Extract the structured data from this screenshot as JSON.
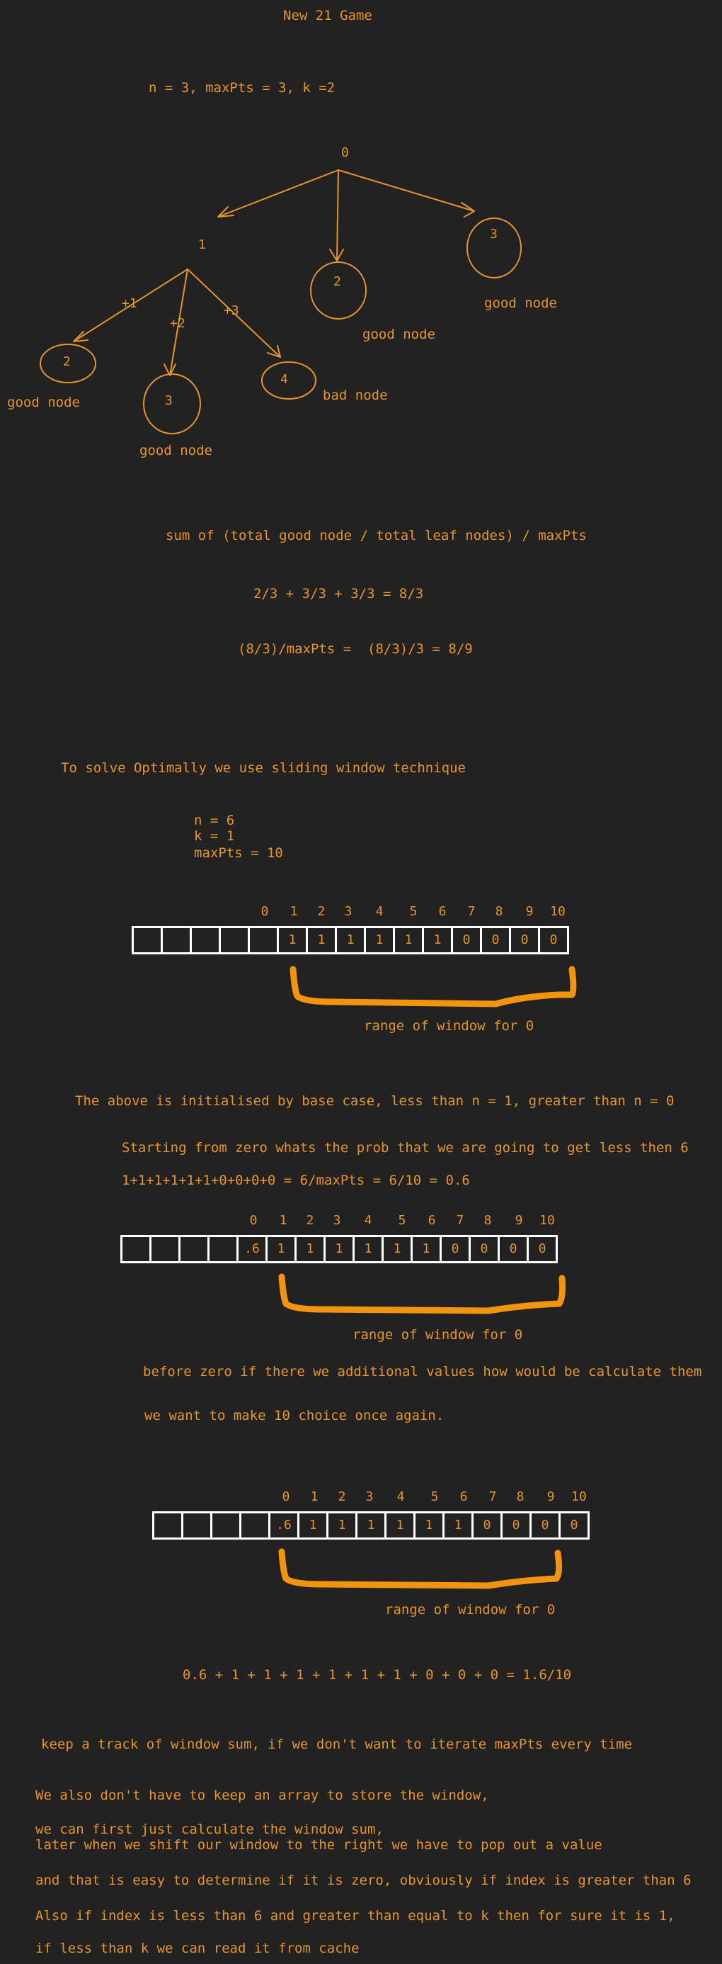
{
  "title": "New 21 Game",
  "params1": "n = 3, maxPts = 3, k =2",
  "tree": {
    "root": "0",
    "n1": "1",
    "n2": "2",
    "n3": "3",
    "e1": "+1",
    "e2": "+2",
    "e3": "+3",
    "l2": "2",
    "l3": "3",
    "l4": "4",
    "lbl_good_n3": "good node",
    "lbl_good_n2": "good node",
    "lbl_good_l2": "good node",
    "lbl_good_l3": "good node",
    "lbl_bad_l4": "bad node"
  },
  "formula1": "sum of (total good node / total leaf nodes) / maxPts",
  "formula2": "2/3 + 3/3 + 3/3 = 8/3",
  "formula3": "(8/3)/maxPts =  (8/3)/3 = 8/9",
  "sliding_title": "To solve Optimally we use sliding window technique",
  "params2": [
    "n = 6",
    "k = 1",
    "maxPts = 10"
  ],
  "indices": [
    "0",
    "1",
    "2",
    "3",
    "4",
    "5",
    "6",
    "7",
    "8",
    "9",
    "10"
  ],
  "array1": [
    "",
    "",
    "",
    "",
    "",
    "1",
    "1",
    "1",
    "1",
    "1",
    "1",
    "0",
    "0",
    "0",
    "0"
  ],
  "array2": [
    "",
    "",
    "",
    "",
    ".6",
    "1",
    "1",
    "1",
    "1",
    "1",
    "1",
    "0",
    "0",
    "0",
    "0"
  ],
  "array3": [
    "",
    "",
    "",
    "",
    ".6",
    "1",
    "1",
    "1",
    "1",
    "1",
    "1",
    "0",
    "0",
    "0",
    "0"
  ],
  "range_label": "range of window for 0",
  "note1": "The above is initialised by base case, less than n = 1, greater than n = 0",
  "note2": "Starting from zero whats the prob that we are going to get less then 6",
  "note3": "1+1+1+1+1+1+0+0+0+0 = 6/maxPts = 6/10 = 0.6",
  "note4": "before zero if there we additional values how would be calculate them",
  "note5": "we want to make 10 choice once again.",
  "note6": "0.6 + 1 + 1 + 1 + 1 + 1 + 1 + 0 + 0 + 0 = 1.6/10",
  "note7": "keep a track of window sum, if we don't want to iterate maxPts every time",
  "note8": "We also don't have to keep an array to store the window,",
  "note9": "we can first just calculate the window sum,",
  "note10": "later when we shift our window to the right we have to pop out a value",
  "note11": "and that is easy to determine if it is zero, obviously if index is greater than 6",
  "note12": "Also if index is less than 6 and greater than equal to k then for sure it is 1,",
  "note13": "if less than k we can read it from cache",
  "colors": {
    "background": "#222222",
    "ink": "#e8942a",
    "box": "#ffffff"
  }
}
